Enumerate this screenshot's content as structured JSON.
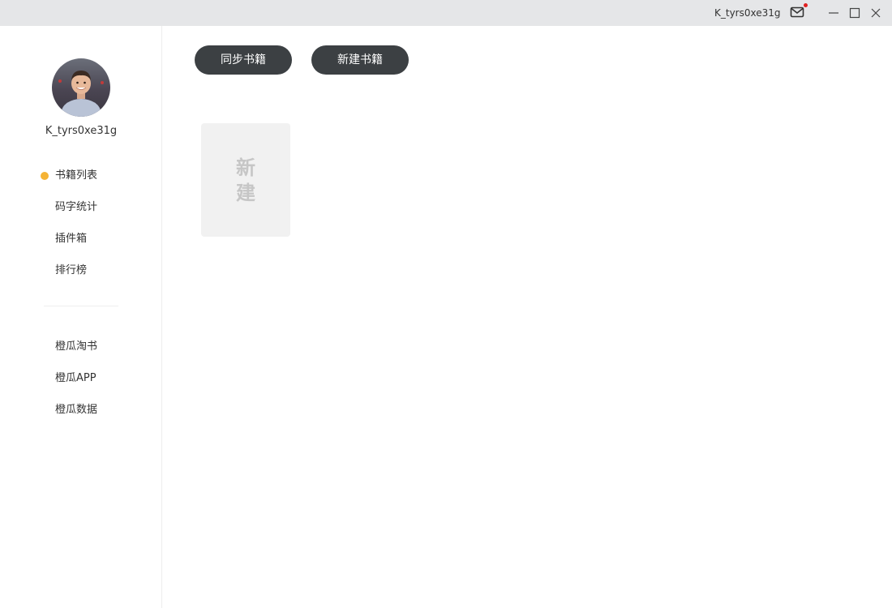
{
  "titlebar": {
    "username": "K_tyrs0xe31g",
    "mail_icon": "mail-icon",
    "notification_color": "#e02020",
    "window_controls": [
      "minimize-icon",
      "maximize-icon",
      "close-icon"
    ]
  },
  "sidebar": {
    "username": "K_tyrs0xe31g",
    "active_color": "#f5b335",
    "nav_items": [
      {
        "label": "书籍列表",
        "active": true
      },
      {
        "label": "码字统计",
        "active": false
      },
      {
        "label": "插件箱",
        "active": false
      },
      {
        "label": "排行榜",
        "active": false
      }
    ],
    "secondary_items": [
      {
        "label": "橙瓜淘书"
      },
      {
        "label": "橙瓜APP"
      },
      {
        "label": "橙瓜数据"
      }
    ]
  },
  "toolbar": {
    "sync_label": "同步书籍",
    "new_label": "新建书籍"
  },
  "new_card": {
    "line1": "新",
    "line2": "建"
  }
}
